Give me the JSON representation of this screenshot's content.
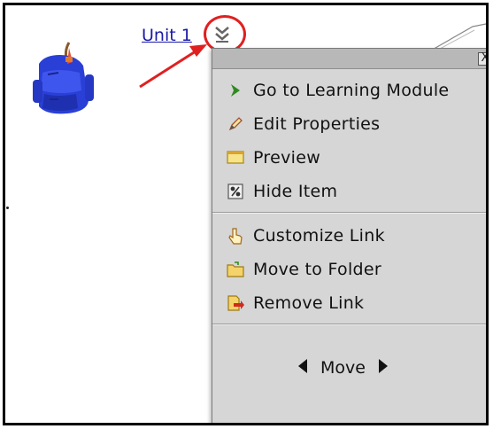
{
  "unit_link": "Unit 1",
  "menu": {
    "close_label": "X",
    "items": [
      {
        "label": "Go to Learning Module",
        "icon": "green-chevron-icon"
      },
      {
        "label": "Edit Properties",
        "icon": "pencil-icon"
      },
      {
        "label": "Preview",
        "icon": "preview-window-icon"
      },
      {
        "label": "Hide Item",
        "icon": "hide-item-icon"
      },
      {
        "label": "Customize Link",
        "icon": "hand-pointer-icon"
      },
      {
        "label": "Move to Folder",
        "icon": "folder-icon"
      },
      {
        "label": "Remove Link",
        "icon": "remove-link-icon"
      }
    ],
    "move_label": "Move"
  },
  "colors": {
    "link": "#1a1aa8",
    "highlight": "#e02020",
    "menu_bg": "#d6d6d6",
    "menu_header": "#b8b8b8"
  }
}
